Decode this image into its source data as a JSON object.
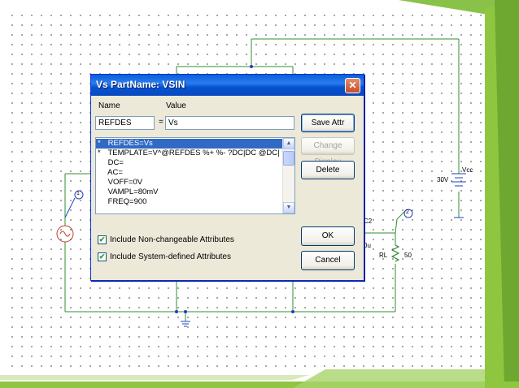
{
  "schematic": {
    "source_voltage": "30V",
    "source_name": "Vcc",
    "node_1": "1",
    "node_2": "2",
    "cap_label": "C2",
    "cap_value": "0u",
    "resistor_name": "RL",
    "resistor_value": "50"
  },
  "dialog": {
    "title": "Vs   PartName: VSIN",
    "close_glyph": "✕",
    "name_header": "Name",
    "value_header": "Value",
    "name_field": "REFDES",
    "equals": "=",
    "value_field": "Vs",
    "buttons": {
      "save_attr": "Save Attr",
      "change_display": "Change Display",
      "delete": "Delete",
      "ok": "OK",
      "cancel": "Cancel"
    },
    "attributes": [
      {
        "star": "*",
        "text": "REFDES=Vs"
      },
      {
        "star": "*",
        "text": "TEMPLATE=V^@REFDES %+ %- ?DC|DC @DC| ?AC|AC @AC|"
      },
      {
        "star": "",
        "text": "DC="
      },
      {
        "star": "",
        "text": "AC="
      },
      {
        "star": "",
        "text": "VOFF=0V"
      },
      {
        "star": "",
        "text": "VAMPL=80mV"
      },
      {
        "star": "",
        "text": "FREQ=900"
      }
    ],
    "check_nonchangeable": "Include Non-changeable Attributes",
    "check_system": "Include System-defined Attributes",
    "check_glyph": "✔",
    "scroll_up": "▲",
    "scroll_down": "▼"
  }
}
